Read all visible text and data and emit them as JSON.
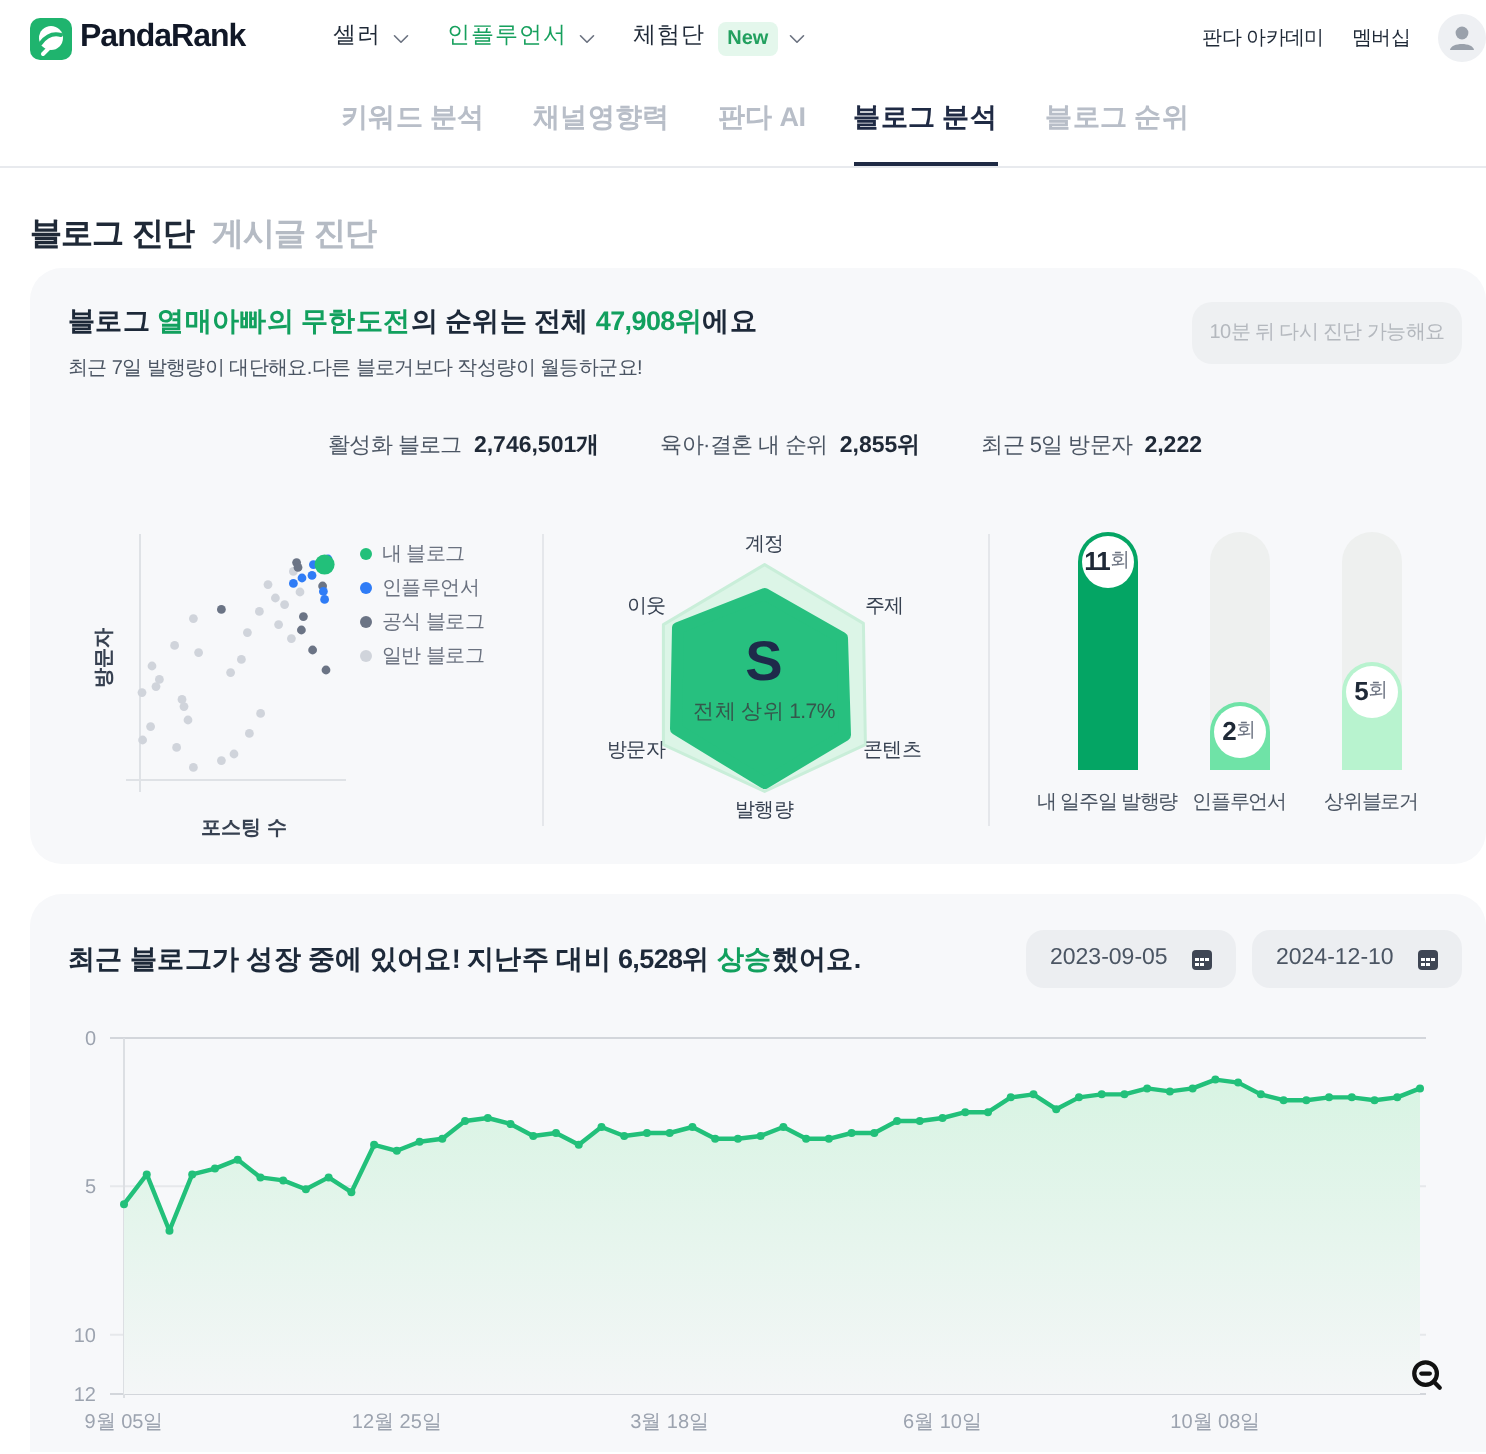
{
  "header": {
    "logo": "PandaRank",
    "nav": [
      {
        "label": "셀러",
        "selected": false
      },
      {
        "label": "인플루언서",
        "selected": true
      },
      {
        "label": "체험단",
        "selected": false,
        "badge": "New"
      }
    ],
    "links": [
      "판다 아카데미",
      "멤버십"
    ]
  },
  "tabs": [
    {
      "label": "키워드 분석",
      "selected": false
    },
    {
      "label": "채널영향력",
      "selected": false
    },
    {
      "label": "판다 AI",
      "selected": false
    },
    {
      "label": "블로그 분석",
      "selected": true
    },
    {
      "label": "블로그 순위",
      "selected": false
    }
  ],
  "section_tabs": [
    {
      "label": "블로그 진단",
      "selected": true
    },
    {
      "label": "게시글 진단",
      "selected": false
    }
  ],
  "diagnosis": {
    "headline": [
      {
        "text": "블로그 ",
        "highlight": false
      },
      {
        "text": "열매아빠의 무한도전",
        "highlight": true
      },
      {
        "text": "의 순위는 전체 ",
        "highlight": false
      },
      {
        "text": "47,908위",
        "highlight": true
      },
      {
        "text": "에요",
        "highlight": false
      }
    ],
    "subtext": "최근 7일 발행량이 대단해요.다른 블로거보다 작성량이 월등하군요!",
    "retry_button": {
      "label": "10분 뒤 다시 진단 가능해요",
      "disabled": true
    },
    "stats": [
      {
        "label": "활성화 블로그",
        "value": "2,746,501개"
      },
      {
        "label": "육아·결혼 내 순위",
        "value": "2,855위"
      },
      {
        "label": "최근 5일 방문자",
        "value": "2,222"
      }
    ]
  },
  "scatter": {
    "ylabel": "방문자",
    "xlabel": "포스팅 수",
    "legend": [
      {
        "label": "내 블로그",
        "color": "#22c07a"
      },
      {
        "label": "인플루언서",
        "color": "#2f7cf6"
      },
      {
        "label": "공식 블로그",
        "color": "#6b7485"
      },
      {
        "label": "일반 블로그",
        "color": "#d0d4db"
      }
    ]
  },
  "radar": {
    "axes": [
      "계정",
      "주제",
      "콘텐츠",
      "발행량",
      "방문자",
      "이웃"
    ],
    "grade": "S",
    "caption": "전체 상위 1.7%"
  },
  "publishing": [
    {
      "value": "11",
      "unit": "회",
      "label": "내 일주일 발행량",
      "level": 1,
      "color": "#04a564"
    },
    {
      "value": "2",
      "unit": "회",
      "label": "인플루언서",
      "level": 0.29,
      "color": "#6fe3a7"
    },
    {
      "value": "5",
      "unit": "회",
      "label": "상위블로거",
      "level": 0.45,
      "color": "#b8f3cf"
    }
  ],
  "trend": {
    "headline": [
      {
        "text": "최근 블로그가 성장 중에 있어요! 지난주 대비 6,528위 ",
        "highlight": false
      },
      {
        "text": "상승",
        "highlight": true
      },
      {
        "text": "했어요.",
        "highlight": false
      }
    ],
    "date_from": "2023-09-05",
    "date_to": "2024-12-10",
    "chart_data": {
      "type": "line",
      "marker": "circle",
      "categories": [
        "9월 05일",
        null,
        null,
        null,
        null,
        null,
        null,
        null,
        null,
        null,
        null,
        null,
        "12월 25일",
        null,
        null,
        null,
        null,
        null,
        null,
        null,
        null,
        null,
        null,
        null,
        "3월 18일",
        null,
        null,
        null,
        null,
        null,
        null,
        null,
        null,
        null,
        null,
        null,
        "6월 10일",
        null,
        null,
        null,
        null,
        null,
        null,
        null,
        null,
        null,
        null,
        null,
        "10월 08일",
        null,
        null,
        null,
        null,
        null,
        null,
        null,
        null,
        null
      ],
      "values": [
        5.6,
        4.6,
        6.5,
        4.6,
        4.4,
        4.1,
        4.7,
        4.8,
        5.1,
        4.7,
        5.2,
        3.6,
        3.8,
        3.5,
        3.4,
        2.8,
        2.7,
        2.9,
        3.3,
        3.2,
        3.6,
        3.0,
        3.3,
        3.2,
        3.2,
        3.0,
        3.4,
        3.4,
        3.3,
        3.0,
        3.4,
        3.4,
        3.2,
        3.2,
        2.8,
        2.8,
        2.7,
        2.5,
        2.5,
        2.0,
        1.9,
        2.4,
        2.0,
        1.9,
        1.9,
        1.7,
        1.8,
        1.7,
        1.4,
        1.5,
        1.9,
        2.1,
        2.1,
        2.0,
        2.0,
        2.1,
        2.0,
        1.7
      ],
      "ylim": [
        12,
        0
      ],
      "yticks": [
        0,
        5,
        10,
        12
      ]
    }
  }
}
